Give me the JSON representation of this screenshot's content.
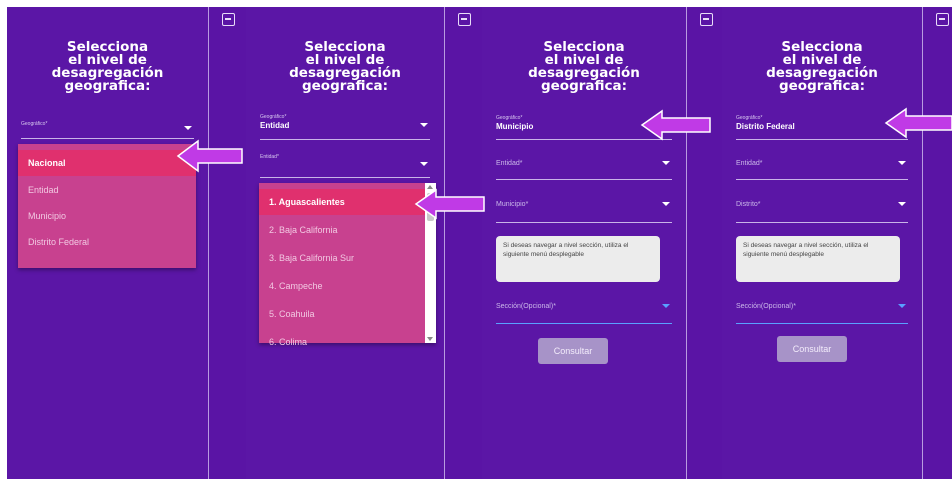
{
  "common": {
    "title_line1": "Selecciona",
    "title_line2": "el nivel de",
    "title_line3": "desagregación",
    "title_line4": "geografica:",
    "geo_small_label": "Geográfico*"
  },
  "panel1": {
    "menu_items": [
      "Nacional",
      "Entidad",
      "Municipio",
      "Distrito Federal"
    ]
  },
  "panel2": {
    "geo_value": "Entidad",
    "entidad_label": "Entidad*",
    "menu_items": [
      "1. Aguascalientes",
      "2. Baja California",
      "3. Baja California Sur",
      "4. Campeche",
      "5. Coahuila",
      "6. Colima"
    ]
  },
  "panel3": {
    "geo_value": "Municipio",
    "entidad_label": "Entidad*",
    "second_label": "Municipio*",
    "info_text": "Si deseas navegar a nivel sección, utiliza el siguiente menú desplegable",
    "seccion_label": "Sección(Opcional)*",
    "button": "Consultar"
  },
  "panel4": {
    "geo_value": "Distrito Federal",
    "entidad_label": "Entidad*",
    "second_label": "Distrito*",
    "info_text": "Si deseas navegar a nivel sección, utiliza el siguiente menú desplegable",
    "seccion_label": "Sección(Opcional)*",
    "button": "Consultar"
  },
  "colors": {
    "panel_bg": "#5b16a6",
    "menu_bg": "#c8418f",
    "menu_selected": "#e0306e",
    "arrow": "#c03ae6",
    "button_bg": "#a793c8"
  }
}
